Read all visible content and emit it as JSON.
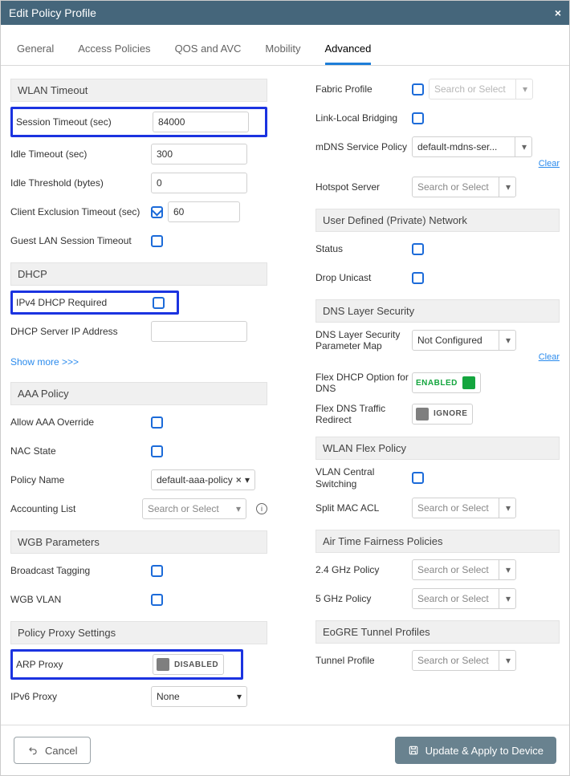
{
  "dialog": {
    "title": "Edit Policy Profile",
    "close": "×"
  },
  "tabs": {
    "general": "General",
    "access": "Access Policies",
    "qos": "QOS and AVC",
    "mobility": "Mobility",
    "advanced": "Advanced"
  },
  "sections": {
    "wlan_timeout": "WLAN Timeout",
    "dhcp": "DHCP",
    "aaa": "AAA Policy",
    "wgb": "WGB Parameters",
    "proxy": "Policy Proxy Settings",
    "udn": "User Defined (Private) Network",
    "dns_sec": "DNS Layer Security",
    "flex": "WLAN Flex Policy",
    "atf": "Air Time Fairness Policies",
    "eogre": "EoGRE Tunnel Profiles"
  },
  "left": {
    "session_timeout": {
      "label": "Session Timeout (sec)",
      "value": "84000"
    },
    "idle_timeout": {
      "label": "Idle Timeout (sec)",
      "value": "300"
    },
    "idle_threshold": {
      "label": "Idle Threshold (bytes)",
      "value": "0"
    },
    "client_excl": {
      "label": "Client Exclusion Timeout (sec)",
      "value": "60"
    },
    "guest_lan": {
      "label": "Guest LAN Session Timeout"
    },
    "dhcp_required": {
      "label": "IPv4 DHCP Required"
    },
    "dhcp_server": {
      "label": "DHCP Server IP Address",
      "value": ""
    },
    "show_more": "Show more >>>",
    "aaa_override": {
      "label": "Allow AAA Override"
    },
    "nac_state": {
      "label": "NAC State"
    },
    "policy_name": {
      "label": "Policy Name",
      "value": "default-aaa-policy"
    },
    "accounting": {
      "label": "Accounting List",
      "placeholder": "Search or Select"
    },
    "broadcast": {
      "label": "Broadcast Tagging"
    },
    "wgb_vlan": {
      "label": "WGB VLAN"
    },
    "arp_proxy": {
      "label": "ARP Proxy",
      "state": "DISABLED"
    },
    "ipv6_proxy": {
      "label": "IPv6 Proxy",
      "value": "None"
    }
  },
  "right": {
    "fabric": {
      "label": "Fabric Profile",
      "placeholder": "Search or Select"
    },
    "link_local": {
      "label": "Link-Local Bridging"
    },
    "mdns": {
      "label": "mDNS Service Policy",
      "value": "default-mdns-ser...",
      "clear": "Clear"
    },
    "hotspot": {
      "label": "Hotspot Server",
      "placeholder": "Search or Select"
    },
    "status": {
      "label": "Status"
    },
    "drop_unicast": {
      "label": "Drop Unicast"
    },
    "dns_map": {
      "label": "DNS Layer Security Parameter Map",
      "value": "Not Configured",
      "clear": "Clear"
    },
    "flex_dhcp": {
      "label": "Flex DHCP Option for DNS",
      "state": "ENABLED"
    },
    "flex_redirect": {
      "label": "Flex DNS Traffic Redirect",
      "state": "IGNORE"
    },
    "vlan_central": {
      "label": "VLAN Central Switching"
    },
    "split_mac": {
      "label": "Split MAC ACL",
      "placeholder": "Search or Select"
    },
    "p24": {
      "label": "2.4 GHz Policy",
      "placeholder": "Search or Select"
    },
    "p5": {
      "label": "5 GHz Policy",
      "placeholder": "Search or Select"
    },
    "tunnel": {
      "label": "Tunnel Profile",
      "placeholder": "Search or Select"
    }
  },
  "footer": {
    "cancel": "Cancel",
    "apply": "Update & Apply to Device"
  }
}
